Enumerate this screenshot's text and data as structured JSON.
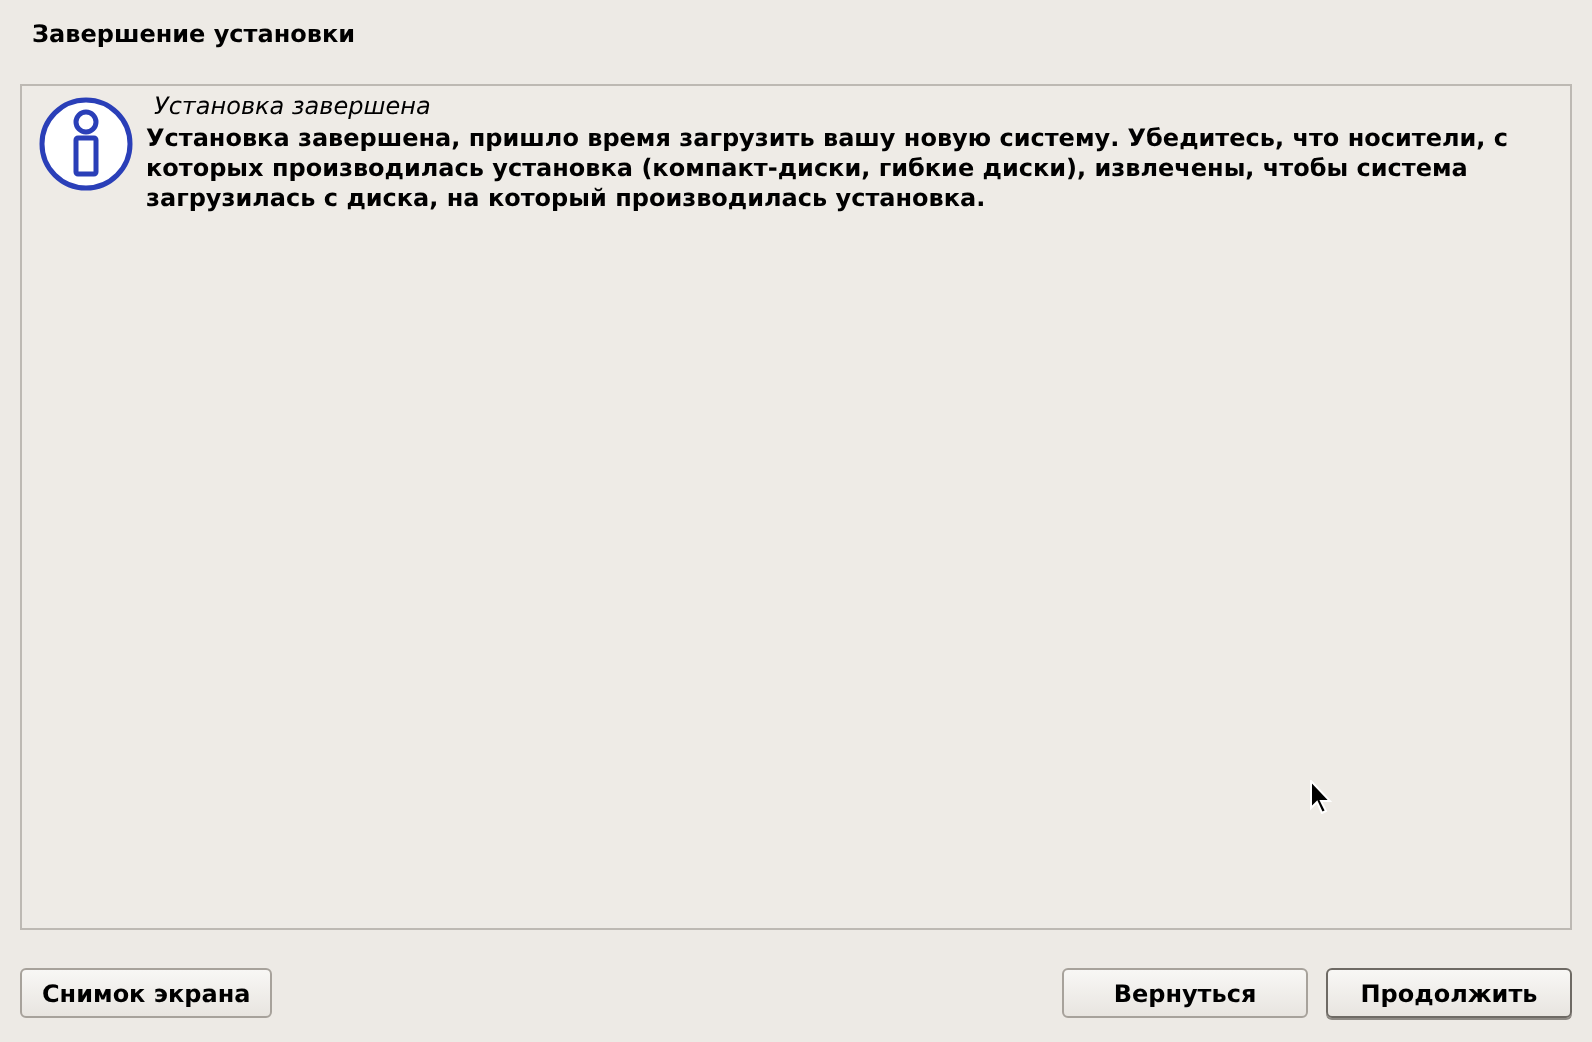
{
  "window": {
    "title": "Завершение установки"
  },
  "message": {
    "heading": "Установка завершена",
    "body": "Установка завершена, пришло время загрузить вашу новую систему. Убедитесь, что носители, с которых производилась установка (компакт-диски, гибкие диски), извлечены, чтобы система загрузилась с диска, на который производилась установка."
  },
  "buttons_left": [
    {
      "label": "Снимок экрана",
      "default": false
    }
  ],
  "buttons_right": [
    {
      "label": "Вернуться",
      "default": false
    },
    {
      "label": "Продолжить",
      "default": true
    }
  ]
}
